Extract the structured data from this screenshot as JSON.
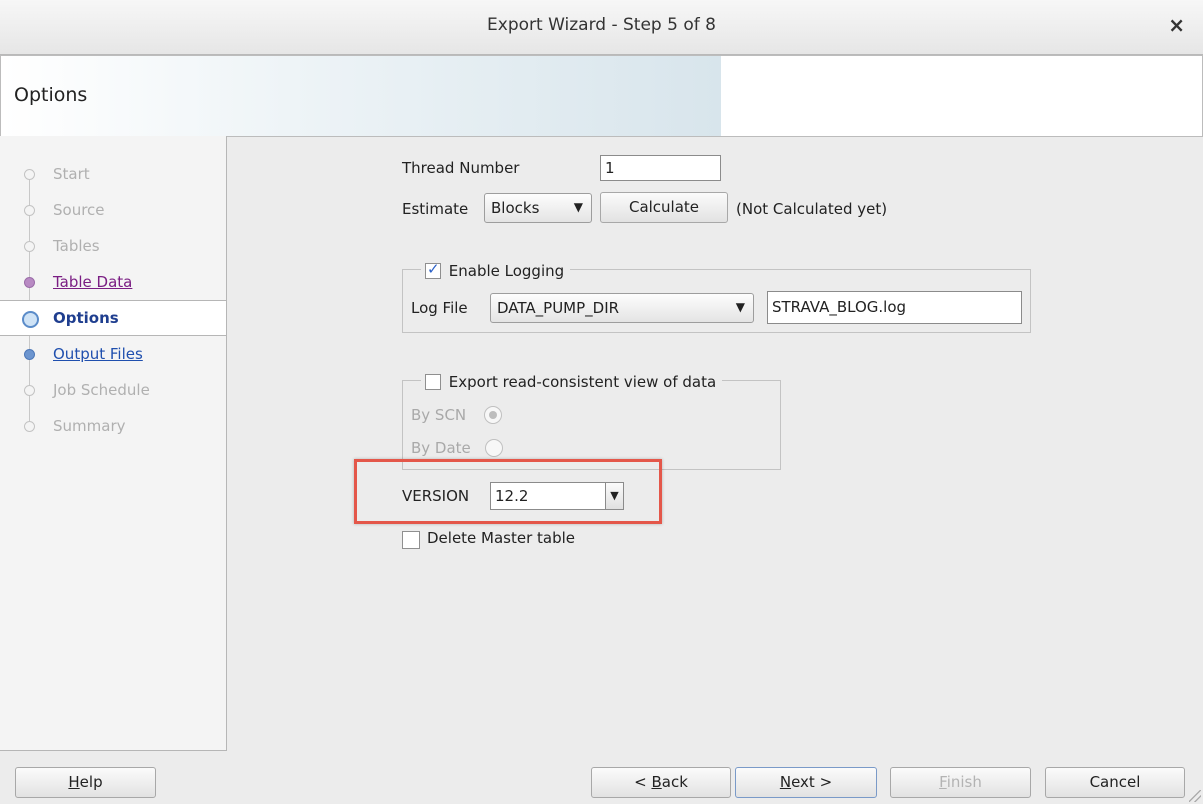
{
  "window": {
    "title": "Export Wizard - Step 5 of 8",
    "close_glyph": "×"
  },
  "header": {
    "title": "Options"
  },
  "nav": {
    "items": [
      {
        "label": "Start",
        "state": "disabled"
      },
      {
        "label": "Source",
        "state": "disabled"
      },
      {
        "label": "Tables",
        "state": "disabled"
      },
      {
        "label": "Table Data",
        "state": "visited"
      },
      {
        "label": "Options",
        "state": "current"
      },
      {
        "label": "Output Files",
        "state": "link"
      },
      {
        "label": "Job Schedule",
        "state": "disabled"
      },
      {
        "label": "Summary",
        "state": "disabled"
      }
    ]
  },
  "form": {
    "thread_number": {
      "label": "Thread Number",
      "value": "1"
    },
    "estimate": {
      "label": "Estimate",
      "selected": "Blocks",
      "calculate_label": "Calculate",
      "status": "(Not Calculated yet)"
    },
    "logging": {
      "checkbox_label": "Enable Logging",
      "checked": true,
      "log_file_label": "Log File",
      "directory": "DATA_PUMP_DIR",
      "filename": "STRAVA_BLOG.log"
    },
    "read_consistent": {
      "checkbox_label": "Export read-consistent view of data",
      "checked": false,
      "by_scn_label": "By SCN",
      "by_date_label": "By Date"
    },
    "version": {
      "label": "VERSION",
      "value": "12.2"
    },
    "delete_master": {
      "label": "Delete Master table",
      "checked": false
    }
  },
  "buttons": {
    "help": "Help",
    "help_mnemonic": "H",
    "help_rest": "elp",
    "back_prefix": "< ",
    "back_mnemonic": "B",
    "back_rest": "ack",
    "next_mnemonic": "N",
    "next_rest": "ext >",
    "finish_mnemonic": "F",
    "finish_rest": "inish",
    "cancel": "Cancel"
  }
}
